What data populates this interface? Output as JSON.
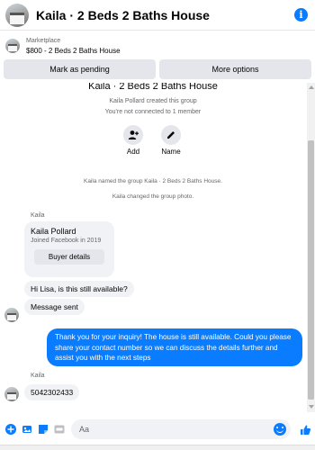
{
  "header": {
    "title": "Kaila · 2 Beds 2 Baths House",
    "info_icon": "info-icon"
  },
  "marketplace": {
    "label": "Marketplace",
    "listing": "$800 - 2 Beds 2 Baths House"
  },
  "actions": {
    "mark_pending": "Mark as pending",
    "more_options": "More options"
  },
  "thread": {
    "group_name": "Kaila · 2 Beds 2 Baths House",
    "created": "Kaila Pollard created this group",
    "connected": "You're not connected to 1 member",
    "group_actions": [
      {
        "label": "Add",
        "icon": "add-person-icon"
      },
      {
        "label": "Name",
        "icon": "pencil-icon"
      }
    ],
    "system_messages": [
      "Kaila named the group Kaila · 2 Beds 2 Baths House.",
      "Kaila changed the group photo."
    ],
    "sender_label_1": "Kaila",
    "profile_card": {
      "name": "Kaila Pollard",
      "joined": "Joined Facebook in 2019",
      "button": "Buyer details"
    },
    "messages_in_1": [
      "Hi Lisa, is this still available?",
      "Message sent"
    ],
    "message_out": "Thank you for your inquiry! The house is still available. Could you please share your contact number so we can discuss the details further and assist you with the next steps",
    "sender_label_2": "Kaila",
    "message_in_2": "5042302433"
  },
  "composer": {
    "placeholder": "Aa",
    "icons": [
      "plus-icon",
      "camera-icon",
      "sticker-icon",
      "gif-icon",
      "emoji-icon",
      "thumbs-up-icon"
    ]
  },
  "colors": {
    "accent": "#0a7cff",
    "bubble_in": "#f0f2f5",
    "button_bg": "#e4e6eb",
    "secondary_text": "#65676b"
  }
}
